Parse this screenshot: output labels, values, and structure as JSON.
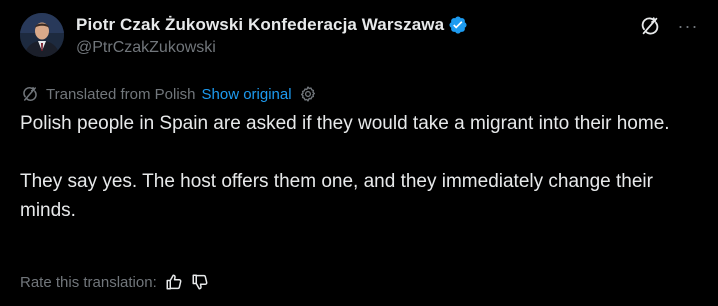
{
  "author": {
    "display_name": "Piotr Czak Żukowski Konfederacja Warszawa",
    "handle": "@PtrCzakZukowski",
    "verified": true,
    "verified_color": "#1d9bf0"
  },
  "header_actions": {
    "translate_icon": "translate-off-icon",
    "more_label": "···"
  },
  "translation": {
    "translated_label": "Translated from Polish",
    "show_original_label": "Show original",
    "settings_icon": "gear-icon"
  },
  "tweet": {
    "paragraphs": [
      "Polish people in Spain are asked if they would take a migrant into their home.",
      "They say yes. The host offers them one, and they immediately change their minds."
    ]
  },
  "rating": {
    "label": "Rate this translation:",
    "thumbs_up_icon": "thumbs-up-icon",
    "thumbs_down_icon": "thumbs-down-icon"
  },
  "colors": {
    "background": "#000000",
    "primary_text": "#e7e9ea",
    "secondary_text": "#71767b",
    "link": "#1d9bf0"
  }
}
